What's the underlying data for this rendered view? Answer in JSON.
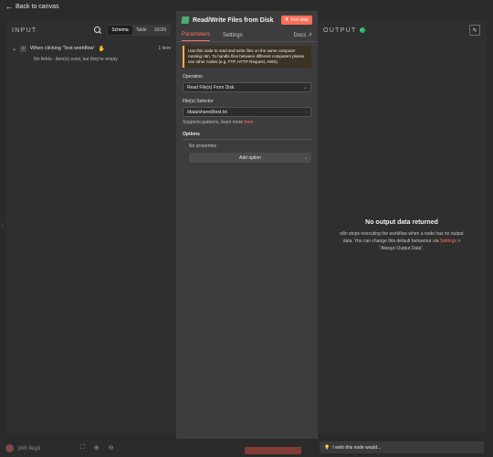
{
  "topbar": {
    "back_label": "Back to canvas"
  },
  "input_panel": {
    "title": "INPUT",
    "view_tabs": [
      "Schema",
      "Table",
      "JSON"
    ],
    "trigger": {
      "label": "When clicking 'Test workflow'",
      "items": "1 item"
    },
    "empty_message": "No fields - item(s) exist, but they're empty"
  },
  "node": {
    "title": "Read/Write Files from Disk",
    "test_step_label": "Test step",
    "tabs": {
      "parameters": "Parameters",
      "settings": "Settings",
      "docs": "Docs"
    },
    "notice": "Use this node to read and write files on the same computer running n8n. To handle files between different computers please use other nodes (e.g. FTP, HTTP Request, AWS).",
    "operation": {
      "label": "Operation",
      "value": "Read File(s) From Disk"
    },
    "file_selector": {
      "label": "File(s) Selector",
      "value": "/data/shared/test.txt"
    },
    "hint": {
      "text": "Supports patterns, learn more",
      "link": "here"
    },
    "options": {
      "label": "Options",
      "no_properties": "No properties",
      "add_option": "Add option"
    }
  },
  "output_panel": {
    "title": "OUTPUT",
    "no_output_title": "No output data returned",
    "no_output_text_before": "n8n stops executing the workflow when a node has no output data. You can change this default behaviour via",
    "settings_link": "Settings",
    "no_output_text_after": "> \"Always Output Data\"."
  },
  "bottom": {
    "user_label": "pkb liegd",
    "feedback": "I wish this node would..."
  }
}
